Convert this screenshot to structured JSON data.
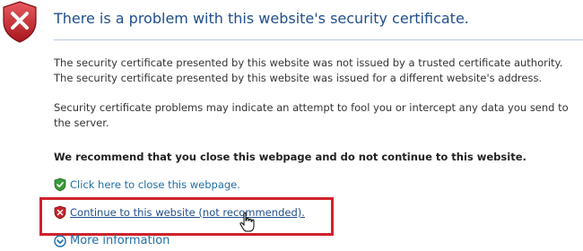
{
  "header": {
    "title": "There is a problem with this website's security certificate."
  },
  "body": {
    "line1": "The security certificate presented by this website was not issued by a trusted certificate authority.",
    "line2": "The security certificate presented by this website was issued for a different website's address.",
    "para2": "Security certificate problems may indicate an attempt to fool you or intercept any data you send to the server.",
    "recommendation": "We recommend that you close this webpage and do not continue to this website."
  },
  "links": {
    "close": "Click here to close this webpage.",
    "continue": "Continue to this website (not recommended).",
    "more_info": "More information"
  },
  "icons": {
    "header": "error-shield-icon",
    "close": "green-check-shield-icon",
    "continue": "red-x-shield-icon",
    "more_info": "chevron-down-circle-icon",
    "cursor": "hand-pointer-icon"
  },
  "colors": {
    "title": "#1f4e8c",
    "link": "#1f6fa8",
    "highlight": "#d0212b",
    "error_shield": "#c8242b",
    "ok_shield": "#3a9a3a"
  }
}
